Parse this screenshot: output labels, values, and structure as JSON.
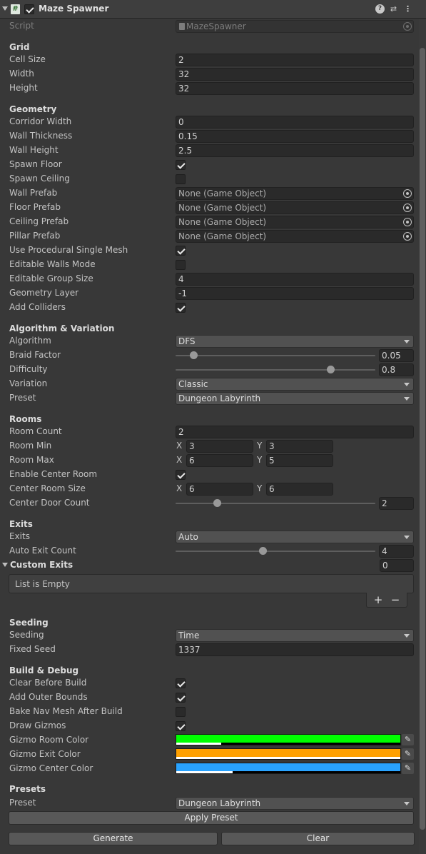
{
  "header": {
    "title": "Maze Spawner",
    "enabled": true
  },
  "script": {
    "label": "Script",
    "value": "MazeSpawner"
  },
  "grid": {
    "title": "Grid",
    "cell_size_label": "Cell Size",
    "cell_size": "2",
    "width_label": "Width",
    "width": "32",
    "height_label": "Height",
    "height": "32"
  },
  "geometry": {
    "title": "Geometry",
    "corridor_width_label": "Corridor Width",
    "corridor_width": "0",
    "wall_thickness_label": "Wall Thickness",
    "wall_thickness": "0.15",
    "wall_height_label": "Wall Height",
    "wall_height": "2.5",
    "spawn_floor_label": "Spawn Floor",
    "spawn_floor": true,
    "spawn_ceiling_label": "Spawn Ceiling",
    "spawn_ceiling": false,
    "wall_prefab_label": "Wall Prefab",
    "wall_prefab": "None (Game Object)",
    "floor_prefab_label": "Floor Prefab",
    "floor_prefab": "None (Game Object)",
    "ceiling_prefab_label": "Ceiling Prefab",
    "ceiling_prefab": "None (Game Object)",
    "pillar_prefab_label": "Pillar Prefab",
    "pillar_prefab": "None (Game Object)",
    "use_procedural_label": "Use Procedural Single Mesh",
    "use_procedural": true,
    "editable_walls_label": "Editable Walls Mode",
    "editable_walls": false,
    "editable_group_size_label": "Editable Group Size",
    "editable_group_size": "4",
    "geometry_layer_label": "Geometry Layer",
    "geometry_layer": "-1",
    "add_colliders_label": "Add Colliders",
    "add_colliders": true
  },
  "algorithm": {
    "title": "Algorithm & Variation",
    "algorithm_label": "Algorithm",
    "algorithm": "DFS",
    "braid_factor_label": "Braid Factor",
    "braid_factor": "0.05",
    "braid_fraction": 0.05,
    "difficulty_label": "Difficulty",
    "difficulty": "0.8",
    "difficulty_fraction": 0.8,
    "variation_label": "Variation",
    "variation": "Classic",
    "preset_label": "Preset",
    "preset": "Dungeon Labyrinth"
  },
  "rooms": {
    "title": "Rooms",
    "room_count_label": "Room Count",
    "room_count": "2",
    "room_min_label": "Room Min",
    "room_min_x": "3",
    "room_min_y": "3",
    "room_max_label": "Room Max",
    "room_max_x": "6",
    "room_max_y": "5",
    "enable_center_label": "Enable Center Room",
    "enable_center": true,
    "center_size_label": "Center Room Size",
    "center_size_x": "6",
    "center_size_y": "6",
    "center_door_label": "Center Door Count",
    "center_door": "2",
    "center_door_fraction": 0.18,
    "x_label": "X",
    "y_label": "Y"
  },
  "exits": {
    "title": "Exits",
    "exits_label": "Exits",
    "exits": "Auto",
    "auto_exit_label": "Auto Exit Count",
    "auto_exit": "4",
    "auto_exit_fraction": 0.43,
    "custom_exits_label": "Custom Exits",
    "custom_exits_count": "0",
    "list_empty": "List is Empty",
    "add_symbol": "+",
    "remove_symbol": "−"
  },
  "seeding": {
    "title": "Seeding",
    "seeding_label": "Seeding",
    "seeding": "Time",
    "fixed_seed_label": "Fixed Seed",
    "fixed_seed": "1337"
  },
  "build": {
    "title": "Build & Debug",
    "clear_before_label": "Clear Before Build",
    "clear_before": true,
    "add_outer_label": "Add Outer Bounds",
    "add_outer": true,
    "bake_nav_label": "Bake Nav Mesh After Build",
    "bake_nav": false,
    "draw_gizmos_label": "Draw Gizmos",
    "draw_gizmos": true,
    "room_color_label": "Gizmo Room Color",
    "room_color": "#00ff00",
    "room_alpha": 0.2,
    "exit_color_label": "Gizmo Exit Color",
    "exit_color": "#ffa000",
    "exit_alpha": 1.0,
    "center_color_label": "Gizmo Center Color",
    "center_color": "#29a3ff",
    "center_alpha": 0.25
  },
  "presets": {
    "title": "Presets",
    "preset_label": "Preset",
    "preset": "Dungeon Labyrinth",
    "apply_label": "Apply Preset"
  },
  "footer": {
    "generate_label": "Generate",
    "clear_label": "Clear"
  }
}
